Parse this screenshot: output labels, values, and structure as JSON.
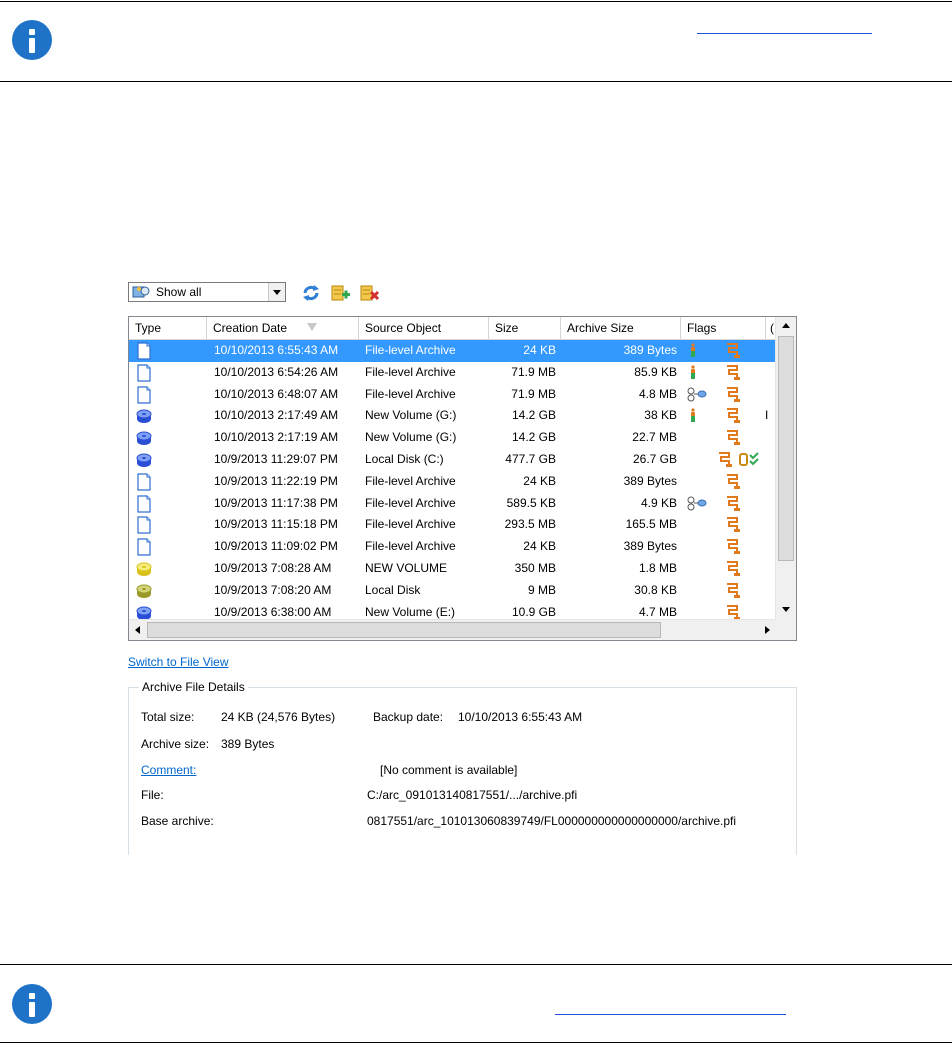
{
  "toolbar": {
    "filter_value": "Show all",
    "refresh_icon": "refresh-icon",
    "add_icon": "add-archive-icon",
    "delete_icon": "delete-archive-icon"
  },
  "list": {
    "columns": [
      "Type",
      "Creation Date",
      "Source Object",
      "Size",
      "Archive Size",
      "Flags",
      "("
    ],
    "rows": [
      {
        "type": "file",
        "date": "10/10/2013 6:55:43 AM",
        "source": "File-level Archive",
        "size": "24 KB",
        "archive_size": "389 Bytes",
        "flags": [
          "info",
          "chain"
        ]
      },
      {
        "type": "file",
        "date": "10/10/2013 6:54:26 AM",
        "source": "File-level Archive",
        "size": "71.9 MB",
        "archive_size": "85.9 KB",
        "flags": [
          "info",
          "chain"
        ]
      },
      {
        "type": "file",
        "date": "10/10/2013 6:48:07 AM",
        "source": "File-level Archive",
        "size": "71.9 MB",
        "archive_size": "4.8 MB",
        "flags": [
          "link",
          "chain"
        ]
      },
      {
        "type": "volume-blue",
        "date": "10/10/2013 2:17:49 AM",
        "source": "New Volume (G:)",
        "size": "14.2 GB",
        "archive_size": "38 KB",
        "flags": [
          "info",
          "chain"
        ],
        "extra": "I"
      },
      {
        "type": "volume-blue",
        "date": "10/10/2013 2:17:19 AM",
        "source": "New Volume (G:)",
        "size": "14.2 GB",
        "archive_size": "22.7 MB",
        "flags": [
          "chain"
        ]
      },
      {
        "type": "volume-blue",
        "date": "10/9/2013 11:29:07 PM",
        "source": "Local Disk (C:)",
        "size": "477.7 GB",
        "archive_size": "26.7 GB",
        "flags": [
          "chain",
          "check"
        ]
      },
      {
        "type": "file",
        "date": "10/9/2013 11:22:19 PM",
        "source": "File-level Archive",
        "size": "24 KB",
        "archive_size": "389 Bytes",
        "flags": [
          "chain"
        ]
      },
      {
        "type": "file",
        "date": "10/9/2013 11:17:38 PM",
        "source": "File-level Archive",
        "size": "589.5 KB",
        "archive_size": "4.9 KB",
        "flags": [
          "link",
          "chain"
        ]
      },
      {
        "type": "file",
        "date": "10/9/2013 11:15:18 PM",
        "source": "File-level Archive",
        "size": "293.5 MB",
        "archive_size": "165.5 MB",
        "flags": [
          "chain"
        ]
      },
      {
        "type": "file",
        "date": "10/9/2013 11:09:02 PM",
        "source": "File-level Archive",
        "size": "24 KB",
        "archive_size": "389 Bytes",
        "flags": [
          "chain"
        ]
      },
      {
        "type": "volume-yellow",
        "date": "10/9/2013 7:08:28 AM",
        "source": "NEW VOLUME",
        "size": "350 MB",
        "archive_size": "1.8 MB",
        "flags": [
          "chain"
        ]
      },
      {
        "type": "volume-olive",
        "date": "10/9/2013 7:08:20 AM",
        "source": "Local Disk",
        "size": "9 MB",
        "archive_size": "30.8 KB",
        "flags": [
          "chain"
        ]
      },
      {
        "type": "volume-blue",
        "date": "10/9/2013 6:38:00 AM",
        "source": "New Volume (E:)",
        "size": "10.9 GB",
        "archive_size": "4.7 MB",
        "flags": [
          "chain"
        ]
      }
    ],
    "selected_index": 0
  },
  "switch_link": "Switch to File View",
  "details": {
    "legend": "Archive File Details",
    "total_size_label": "Total size:",
    "total_size_value": "24 KB (24,576 Bytes)",
    "backup_date_label": "Backup date:",
    "backup_date_value": "10/10/2013 6:55:43 AM",
    "archive_size_label": "Archive size:",
    "archive_size_value": "389 Bytes",
    "comment_label": "Comment:",
    "comment_value": "[No comment is available]",
    "file_label": "File:",
    "file_value": "C:/arc_091013140817551/.../archive.pfi",
    "base_archive_label": "Base archive:",
    "base_archive_value": "0817551/arc_101013060839749/FL000000000000000000/archive.pfi"
  },
  "colors": {
    "selection": "#3399ff",
    "info_icon": "#1e73c8",
    "link": "#0066cc"
  }
}
